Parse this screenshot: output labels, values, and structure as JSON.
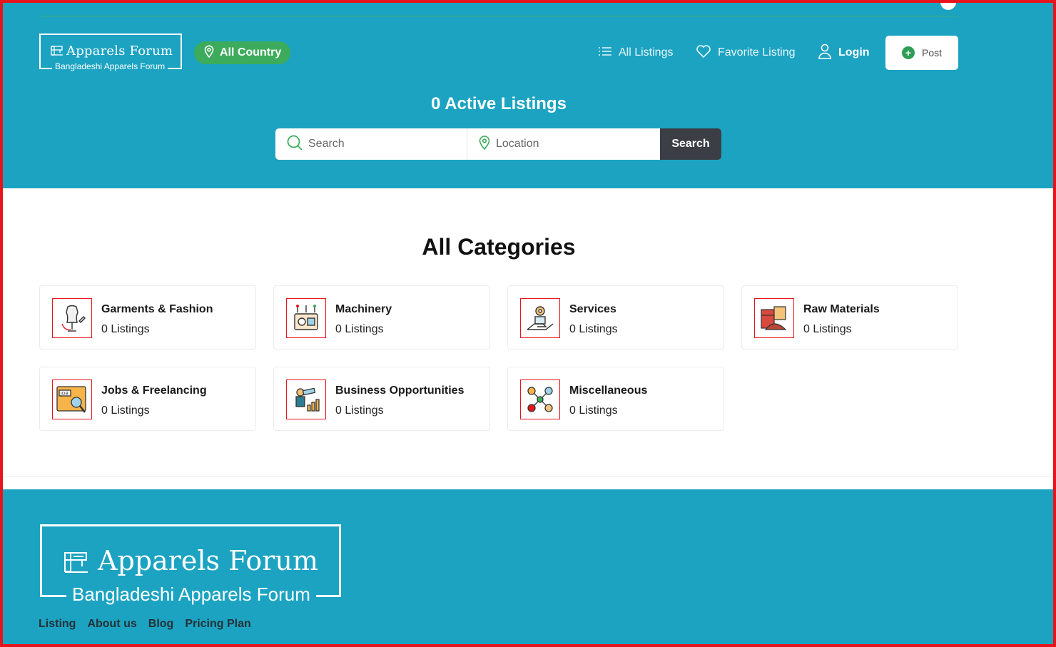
{
  "header": {
    "logo": {
      "title": "Apparels Forum",
      "subtitle": "Bangladeshi Apparels Forum"
    },
    "country_label": "All Country",
    "nav": {
      "all_listings": "All Listings",
      "favorite_listing": "Favorite Listing",
      "login": "Login",
      "post": "Post"
    },
    "headline": "0 Active Listings"
  },
  "search": {
    "keyword_placeholder": "Search",
    "location_placeholder": "Location",
    "button_label": "Search"
  },
  "categories": {
    "title": "All Categories",
    "items": [
      {
        "name": "Garments & Fashion",
        "count": "0 Listings",
        "icon": "mannequin-icon"
      },
      {
        "name": "Machinery",
        "count": "0 Listings",
        "icon": "sewing-machine-icon"
      },
      {
        "name": "Services",
        "count": "0 Listings",
        "icon": "hand-gears-icon"
      },
      {
        "name": "Raw Materials",
        "count": "0 Listings",
        "icon": "materials-icon"
      },
      {
        "name": "Jobs & Freelancing",
        "count": "0 Listings",
        "icon": "job-search-icon"
      },
      {
        "name": "Business Opportunities",
        "count": "0 Listings",
        "icon": "telescope-growth-icon"
      },
      {
        "name": "Miscellaneous",
        "count": "0 Listings",
        "icon": "network-icon"
      }
    ]
  },
  "footer": {
    "logo": {
      "title": "Apparels Forum",
      "subtitle": "Bangladeshi Apparels Forum"
    },
    "links": [
      "Listing",
      "About us",
      "Blog",
      "Pricing Plan"
    ]
  },
  "colors": {
    "brand_teal": "#1ca3c2",
    "accent_green": "#3cab5b",
    "search_button": "#3b3f45",
    "frame_red": "#e8141b"
  }
}
